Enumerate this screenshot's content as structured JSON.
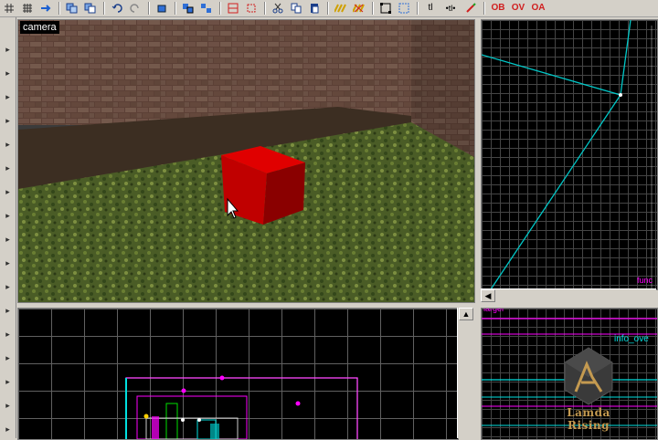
{
  "toolbar": {
    "buttons": [
      "grid-icon",
      "grid-smaller-icon",
      "arrow-icon",
      "copy-icon",
      "paste-icon",
      "undo-icon",
      "redo-icon",
      "object-icon",
      "group-icon",
      "ungroup-icon",
      "texture-icon",
      "entity-icon",
      "cut-icon",
      "copy2-icon",
      "paste2-icon",
      "stripes-icon",
      "hollow-icon",
      "box-select-icon",
      "select-icon",
      "tl-icon",
      "tl-switch-icon",
      "tool-icon",
      "ob-icon",
      "ov-icon",
      "oa-icon"
    ],
    "tl_label": "tl",
    "tl2_label": "•tl•",
    "ob_label": "OB",
    "ov_label": "OV",
    "oa_label": "OA"
  },
  "camera": {
    "label": "camera"
  },
  "top_right_view": {
    "partial_label": "func"
  },
  "bottom_right_view": {
    "label_top": "larger",
    "label_info": "info_ove"
  },
  "logo": {
    "text": "Lamda Rising"
  },
  "colors": {
    "cube": "#c00000",
    "wire_cyan": "#00d0d0",
    "wire_magenta": "#ff00ff"
  }
}
